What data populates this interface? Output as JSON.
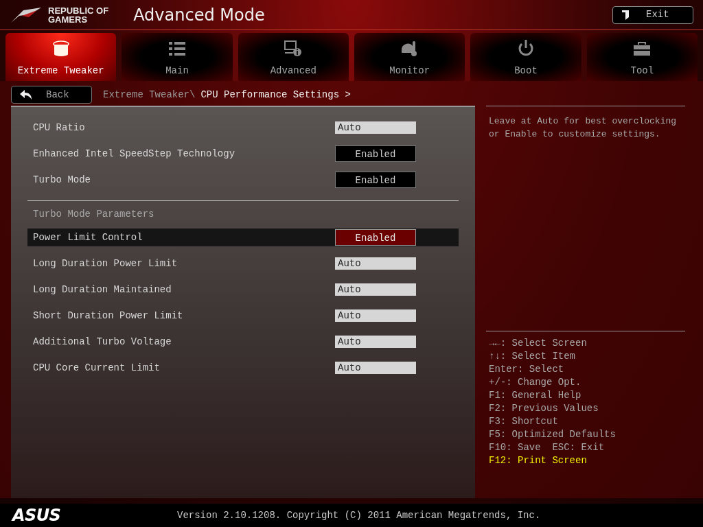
{
  "header": {
    "brand_line1": "REPUBLIC OF",
    "brand_line2": "GAMERS",
    "title": "Advanced Mode",
    "exit_button": "Exit"
  },
  "tabs": [
    {
      "label": "Extreme Tweaker",
      "kind": "tweaker",
      "selected": true
    },
    {
      "label": "Main",
      "kind": "list",
      "selected": false
    },
    {
      "label": "Advanced",
      "kind": "info",
      "selected": false
    },
    {
      "label": "Monitor",
      "kind": "monitor",
      "selected": false
    },
    {
      "label": "Boot",
      "kind": "power",
      "selected": false
    },
    {
      "label": "Tool",
      "kind": "toolbox",
      "selected": false
    }
  ],
  "back_button": "Back",
  "breadcrumb": {
    "parent": "Extreme Tweaker\\",
    "current": "CPU Performance Settings >"
  },
  "settings": [
    {
      "kind": "field",
      "label": "CPU Ratio",
      "value": "Auto",
      "selected": false
    },
    {
      "kind": "select",
      "label": "Enhanced Intel SpeedStep Technology",
      "value": "Enabled",
      "selected": false
    },
    {
      "kind": "select",
      "label": "Turbo Mode",
      "value": "Enabled",
      "selected": false
    },
    {
      "kind": "section",
      "label": "Turbo Mode Parameters"
    },
    {
      "kind": "select",
      "label": "Power Limit Control",
      "value": "Enabled",
      "selected": true
    },
    {
      "kind": "field",
      "label": "Long Duration Power Limit",
      "value": "Auto",
      "selected": false
    },
    {
      "kind": "field",
      "label": "Long Duration Maintained",
      "value": "Auto",
      "selected": false
    },
    {
      "kind": "field",
      "label": "Short Duration Power Limit",
      "value": "Auto",
      "selected": false
    },
    {
      "kind": "field",
      "label": "Additional Turbo Voltage",
      "value": "Auto",
      "selected": false
    },
    {
      "kind": "field",
      "label": "CPU Core Current Limit",
      "value": "Auto",
      "selected": false
    }
  ],
  "help_text": "Leave at Auto for best overclocking or Enable to customize settings.",
  "key_help": [
    {
      "text": "→←: Select Screen",
      "highlighted": false
    },
    {
      "text": "↑↓: Select Item",
      "highlighted": false
    },
    {
      "text": "Enter: Select",
      "highlighted": false
    },
    {
      "text": "+/-: Change Opt.",
      "highlighted": false
    },
    {
      "text": "F1: General Help",
      "highlighted": false
    },
    {
      "text": "F2: Previous Values",
      "highlighted": false
    },
    {
      "text": "F3: Shortcut",
      "highlighted": false
    },
    {
      "text": "F5: Optimized Defaults",
      "highlighted": false
    },
    {
      "text": "F10: Save  ESC: Exit",
      "highlighted": false
    },
    {
      "text": "F12: Print Screen",
      "highlighted": true
    }
  ],
  "footer": {
    "logo": "ASUS",
    "version": "Version 2.10.1208. Copyright (C) 2011 American Megatrends, Inc."
  }
}
